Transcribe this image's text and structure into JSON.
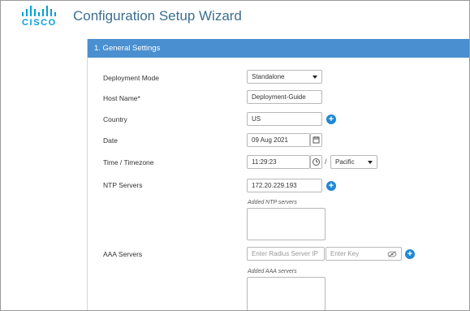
{
  "header": {
    "logo_text": "CISCO",
    "title": "Configuration Setup Wizard"
  },
  "panel": {
    "title": "1. General Settings"
  },
  "form": {
    "deployment_mode": {
      "label": "Deployment Mode",
      "value": "Standalone"
    },
    "host_name": {
      "label": "Host Name*",
      "value": "Deployment-Guide"
    },
    "country": {
      "label": "Country",
      "value": "US"
    },
    "date": {
      "label": "Date",
      "value": "09 Aug 2021"
    },
    "time_timezone": {
      "label": "Time / Timezone",
      "time_value": "11:29:23",
      "separator": "/",
      "timezone_value": "Pacific"
    },
    "ntp_servers": {
      "label": "NTP Servers",
      "value": "172.20.229.193",
      "added_label": "Added NTP servers"
    },
    "aaa_servers": {
      "label": "AAA Servers",
      "server_placeholder": "Enter Radius Server IP",
      "key_placeholder": "Enter Key",
      "added_label": "Added AAA servers"
    }
  },
  "icons": {
    "add": "plus-circle-icon",
    "calendar": "calendar-icon",
    "clock": "clock-icon",
    "eye": "eye-off-icon"
  },
  "colors": {
    "brand": "#049fd9",
    "panel_header": "#4a8fd0",
    "add_button": "#1e88d4",
    "title": "#3d6f8f"
  }
}
